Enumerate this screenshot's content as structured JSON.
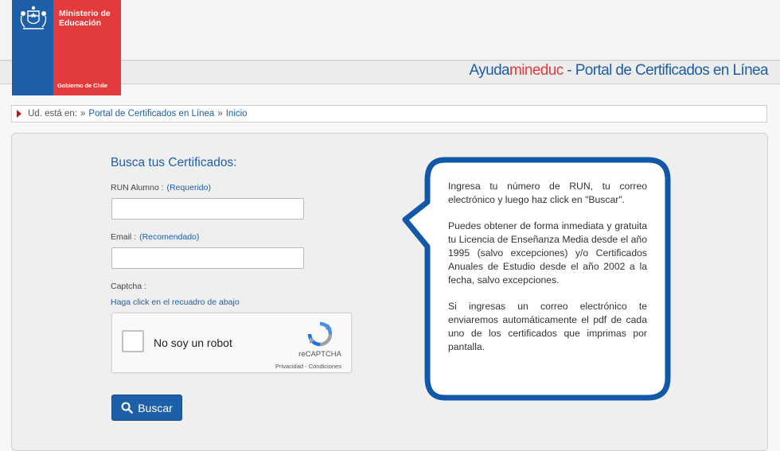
{
  "logo": {
    "title_line1": "Ministerio de",
    "title_line2": "Educación",
    "government": "Gobierno de Chile",
    "colors": {
      "blue": "#1d5fa8",
      "red": "#e33b3b"
    }
  },
  "site_title": {
    "part1": "Ayuda",
    "part2": "mineduc",
    "part3": " - Portal de Certificados en Línea"
  },
  "breadcrumb": {
    "prefix": "Ud. está en:",
    "sep": "»",
    "items": [
      "Portal de Certificados en Línea",
      "Inicio"
    ]
  },
  "form": {
    "title": "Busca tus Certificados:",
    "run_label": "RUN Alumno :",
    "run_hint": "(Requerido)",
    "run_value": "",
    "email_label": "Email :",
    "email_hint": "(Recomendado)",
    "email_value": "",
    "captcha_label": "Captcha :",
    "captcha_hint": "Haga click en el recuadro de abajo",
    "search_button": "Buscar"
  },
  "recaptcha": {
    "label": "No soy un robot",
    "brand": "reCAPTCHA",
    "links": "Privacidad - Condiciones"
  },
  "info": {
    "paragraphs": [
      "Ingresa tu número de RUN, tu correo electrónico y luego haz click en \"Buscar\".",
      "Puedes obtener de forma inmediata y gratuita tu Licencia de Enseñanza Media desde el año 1995 (salvo excepciones) y/o Certificados Anuales de Estudio desde el año 2002 a la fecha, salvo excepciones.",
      "Si ingresas un correo electrónico te enviaremos automáticamente el pdf de cada uno de los certificados que imprimas por pantalla."
    ]
  },
  "icons": {
    "crumb": "arrow-right-icon",
    "seal": "chile-coat-of-arms-icon",
    "search": "magnifier-icon",
    "recaptcha": "recaptcha-logo-icon"
  }
}
